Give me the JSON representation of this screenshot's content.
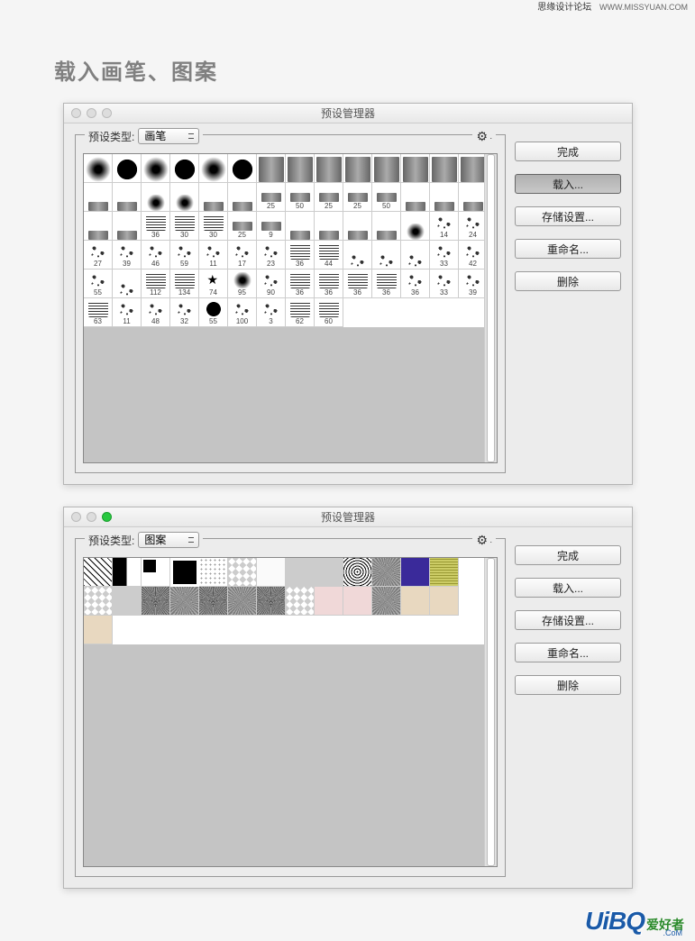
{
  "header": {
    "forum_name": "思缘设计论坛",
    "site_url": "WWW.MISSYUAN.COM"
  },
  "page_title": "载入画笔、图案",
  "window1": {
    "title": "预设管理器",
    "type_label": "预设类型:",
    "type_value": "画笔",
    "buttons": {
      "done": "完成",
      "load": "载入...",
      "save": "存储设置...",
      "rename": "重命名...",
      "delete": "删除"
    },
    "brushes_row1": [
      {
        "label": "",
        "style": "soft"
      },
      {
        "label": "",
        "style": "hard"
      },
      {
        "label": "",
        "style": "soft"
      },
      {
        "label": "",
        "style": "hard"
      },
      {
        "label": "",
        "style": "soft"
      },
      {
        "label": "",
        "style": "hard"
      },
      {
        "label": "",
        "style": "flat"
      },
      {
        "label": "",
        "style": "flat"
      },
      {
        "label": "",
        "style": "flat"
      },
      {
        "label": "",
        "style": "flat"
      },
      {
        "label": "",
        "style": "flat"
      },
      {
        "label": "",
        "style": "flat"
      },
      {
        "label": "",
        "style": "flat"
      },
      {
        "label": "",
        "style": "flat"
      }
    ],
    "brushes_row2": [
      {
        "label": "",
        "style": "flat"
      },
      {
        "label": "",
        "style": "flat"
      },
      {
        "label": "",
        "style": "soft"
      },
      {
        "label": "",
        "style": "soft"
      },
      {
        "label": "",
        "style": "flat"
      },
      {
        "label": "",
        "style": "flat"
      },
      {
        "label": "25",
        "style": "flat"
      },
      {
        "label": "50",
        "style": "flat"
      },
      {
        "label": "25",
        "style": "flat"
      },
      {
        "label": "25",
        "style": "flat"
      },
      {
        "label": "50",
        "style": "flat"
      },
      {
        "label": "",
        "style": "flat"
      },
      {
        "label": "",
        "style": "flat"
      },
      {
        "label": "",
        "style": "flat"
      }
    ],
    "brushes_row3": [
      {
        "label": "",
        "style": "flat"
      },
      {
        "label": "",
        "style": "flat"
      },
      {
        "label": "36",
        "style": "lines"
      },
      {
        "label": "30",
        "style": "lines"
      },
      {
        "label": "30",
        "style": "lines"
      },
      {
        "label": "25",
        "style": "flat"
      },
      {
        "label": "9",
        "style": "flat"
      },
      {
        "label": "",
        "style": "flat"
      },
      {
        "label": "",
        "style": "flat"
      },
      {
        "label": "",
        "style": "flat"
      },
      {
        "label": "",
        "style": "flat"
      },
      {
        "label": "",
        "style": "soft"
      },
      {
        "label": "14",
        "style": "splat"
      },
      {
        "label": "24",
        "style": "splat"
      }
    ],
    "brushes_row4": [
      {
        "label": "27",
        "style": "splat"
      },
      {
        "label": "39",
        "style": "splat"
      },
      {
        "label": "46",
        "style": "splat"
      },
      {
        "label": "59",
        "style": "splat"
      },
      {
        "label": "11",
        "style": "splat"
      },
      {
        "label": "17",
        "style": "splat"
      },
      {
        "label": "23",
        "style": "splat"
      },
      {
        "label": "36",
        "style": "lines"
      },
      {
        "label": "44",
        "style": "lines"
      },
      {
        "label": "",
        "style": "splat"
      },
      {
        "label": "",
        "style": "splat"
      },
      {
        "label": "",
        "style": "splat"
      },
      {
        "label": "33",
        "style": "splat"
      },
      {
        "label": "42",
        "style": "splat"
      }
    ],
    "brushes_row5": [
      {
        "label": "55",
        "style": "splat"
      },
      {
        "label": "",
        "style": "splat"
      },
      {
        "label": "112",
        "style": "lines"
      },
      {
        "label": "134",
        "style": "lines"
      },
      {
        "label": "74",
        "style": "star"
      },
      {
        "label": "95",
        "style": "soft"
      },
      {
        "label": "90",
        "style": "splat"
      },
      {
        "label": "36",
        "style": "lines"
      },
      {
        "label": "36",
        "style": "lines"
      },
      {
        "label": "36",
        "style": "lines"
      },
      {
        "label": "36",
        "style": "lines"
      },
      {
        "label": "36",
        "style": "splat"
      },
      {
        "label": "33",
        "style": "splat"
      },
      {
        "label": "39",
        "style": "splat"
      }
    ],
    "brushes_row6": [
      {
        "label": "63",
        "style": "lines"
      },
      {
        "label": "11",
        "style": "splat"
      },
      {
        "label": "48",
        "style": "splat"
      },
      {
        "label": "32",
        "style": "splat"
      },
      {
        "label": "55",
        "style": "hard"
      },
      {
        "label": "100",
        "style": "splat"
      },
      {
        "label": "3",
        "style": "splat"
      },
      {
        "label": "62",
        "style": "lines"
      },
      {
        "label": "60",
        "style": "lines"
      }
    ]
  },
  "window2": {
    "title": "预设管理器",
    "type_label": "预设类型:",
    "type_value": "图案",
    "buttons": {
      "done": "完成",
      "load": "载入...",
      "save": "存储设置...",
      "rename": "重命名...",
      "delete": "删除"
    },
    "patterns_row1": [
      "diag",
      "half",
      "corner",
      "bw",
      "dots",
      "checker",
      "white",
      "gray",
      "gray",
      "rings",
      "noise",
      "blue",
      "yellow"
    ],
    "patterns_row2": [
      "checker",
      "gray",
      "noise2",
      "noise",
      "noise2",
      "noise",
      "noise2",
      "checker",
      "pink",
      "pink",
      "noise",
      "beige",
      "beige"
    ],
    "patterns_row3": [
      "beige"
    ]
  },
  "watermark": {
    "logo": "UiBQ",
    "tag": "爱好者",
    "sub": ".CoM"
  }
}
